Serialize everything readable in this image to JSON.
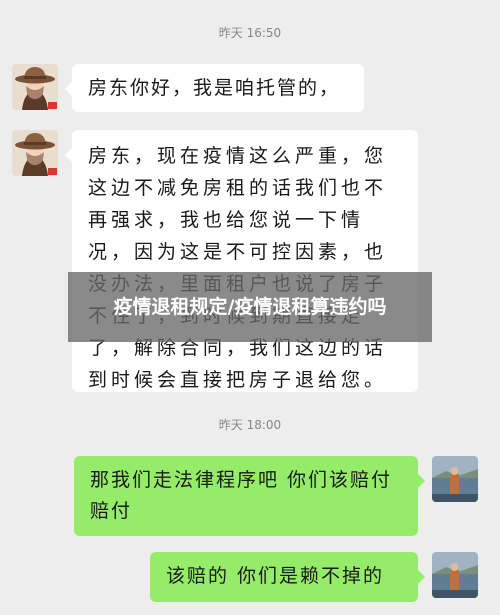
{
  "overlay": {
    "title": "疫情退租规定/疫情退租算违约吗"
  },
  "chat": {
    "timestamp_1": "昨天 16:50",
    "timestamp_2": "昨天 18:00",
    "messages": [
      {
        "sender": "landlord",
        "text": "房东你好，我是咱托管的，"
      },
      {
        "sender": "landlord",
        "text": "房东，现在疫情这么严重，您这边不减免房租的话我们也不再强求，我也给您说一下情况，因为这是不可控因素，也没办法，里面租户也说了房子不住了，到时候到期直接走了，解除合同，我们这边的话到时候会直接把房子退给您。"
      },
      {
        "sender": "me",
        "text": "那我们走法律程序吧 你们该赔付赔付"
      },
      {
        "sender": "me",
        "text": "该赔的 你们是赖不掉的"
      }
    ]
  },
  "colors": {
    "background": "#ededed",
    "incoming_bubble": "#ffffff",
    "outgoing_bubble": "#95ec69",
    "overlay": "#696969"
  },
  "icons": {
    "left_avatar": "cowboy-hat-girl-avatar-icon",
    "right_avatar": "seaside-photo-avatar-icon"
  }
}
